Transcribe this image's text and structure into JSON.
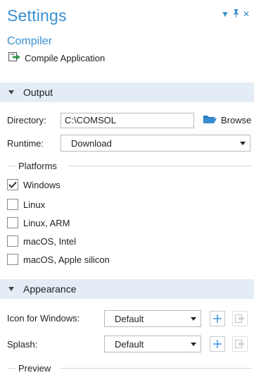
{
  "header": {
    "title": "Settings",
    "subtitle": "Compiler",
    "compile_label": "Compile Application"
  },
  "output": {
    "section_label": "Output",
    "directory_label": "Directory:",
    "directory_value": "C:\\COMSOL",
    "browse_label": "Browse",
    "runtime_label": "Runtime:",
    "runtime_value": "Download",
    "platforms_label": "Platforms",
    "platforms": [
      {
        "label": "Windows",
        "checked": true
      },
      {
        "label": "Linux",
        "checked": false
      },
      {
        "label": "Linux, ARM",
        "checked": false
      },
      {
        "label": "macOS, Intel",
        "checked": false
      },
      {
        "label": "macOS, Apple silicon",
        "checked": false
      }
    ]
  },
  "appearance": {
    "section_label": "Appearance",
    "icon_label": "Icon for Windows:",
    "icon_value": "Default",
    "splash_label": "Splash:",
    "splash_value": "Default",
    "preview_label": "Preview"
  },
  "colors": {
    "accent": "#3a8fd0",
    "section_bg": "#e4ecf5",
    "add_icon": "#4a9be0"
  }
}
